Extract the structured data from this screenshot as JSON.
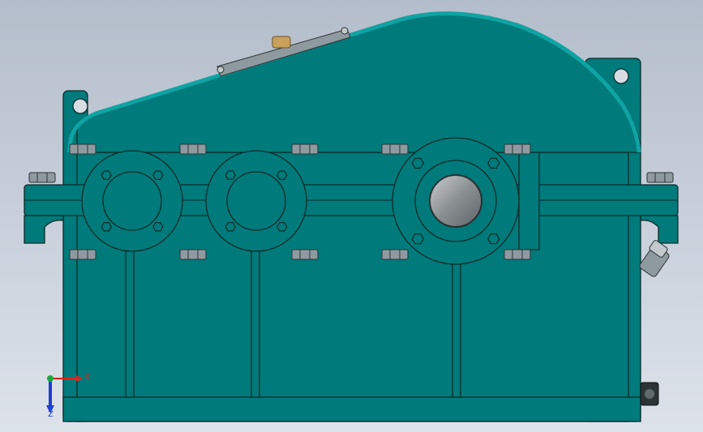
{
  "colors": {
    "bg_top": "#b4bdcb",
    "bg_bottom": "#dde2ea",
    "housing": "#007a7a",
    "housing_light": "#0fa3a3",
    "edge": "#0b2b2b",
    "bolt": "#8e9aa0",
    "bolt_dark": "#2c3436",
    "shaft": "#8a8f92",
    "brass": "#c8a15a",
    "axis_x": "#e0241b",
    "axis_y": "#1fa83a",
    "axis_z": "#1c3fd6"
  },
  "axes": {
    "x_label": "X",
    "z_label": "Z"
  },
  "icons": {
    "triad": "coordinate-triad-icon"
  }
}
